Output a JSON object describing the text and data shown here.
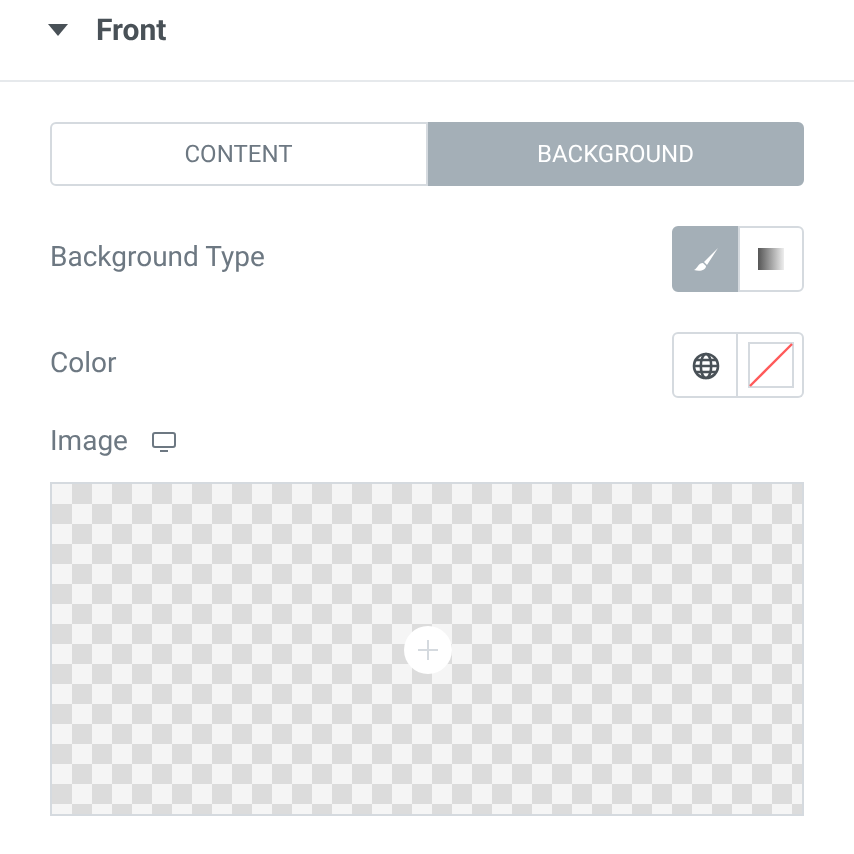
{
  "section": {
    "title": "Front",
    "expanded": true
  },
  "tabs": [
    {
      "label": "CONTENT",
      "selected": false
    },
    {
      "label": "BACKGROUND",
      "selected": true
    }
  ],
  "background_type": {
    "label": "Background Type",
    "options": [
      {
        "kind": "classic",
        "selected": true
      },
      {
        "kind": "gradient",
        "selected": false
      }
    ]
  },
  "color": {
    "label": "Color"
  },
  "image": {
    "label": "Image"
  }
}
